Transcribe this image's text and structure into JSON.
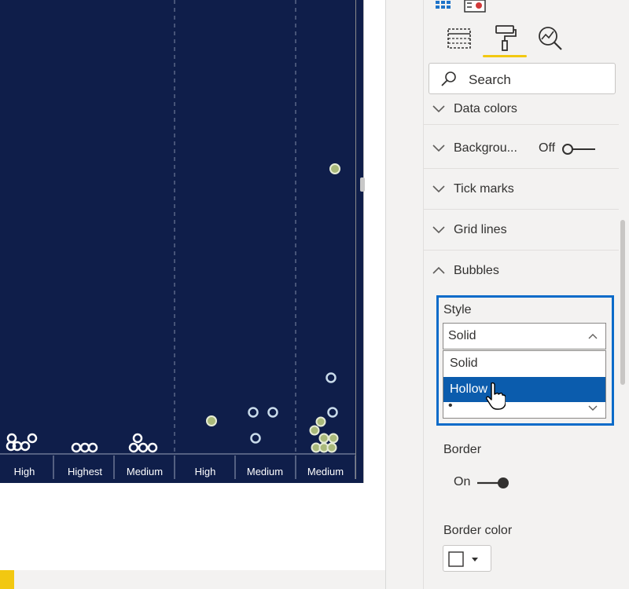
{
  "chart": {
    "x_labels": [
      "High",
      "Highest",
      "Medium",
      "High",
      "Medium",
      "Medium"
    ],
    "colors": {
      "background": "#0f1e4a",
      "bubble_light": "#d9e6f2",
      "bubble_olive": "#a9b97a"
    }
  },
  "pane": {
    "search_placeholder": "Search",
    "sections": [
      {
        "title": "Data colors"
      },
      {
        "title": "Backgrou...",
        "toggle_label": "Off"
      },
      {
        "title": "Tick marks"
      },
      {
        "title": "Grid lines"
      },
      {
        "title": "Bubbles"
      }
    ],
    "style": {
      "label": "Style",
      "selected": "Solid",
      "options": [
        "Solid",
        "Hollow"
      ],
      "marker_select_value": "•"
    },
    "border": {
      "label": "Border",
      "toggle_label": "On"
    },
    "border_color": {
      "label": "Border color"
    }
  },
  "colors": {
    "accent_yellow": "#f2c811",
    "highlight_blue": "#0b6bc9",
    "selected_option": "#0b5cad"
  }
}
